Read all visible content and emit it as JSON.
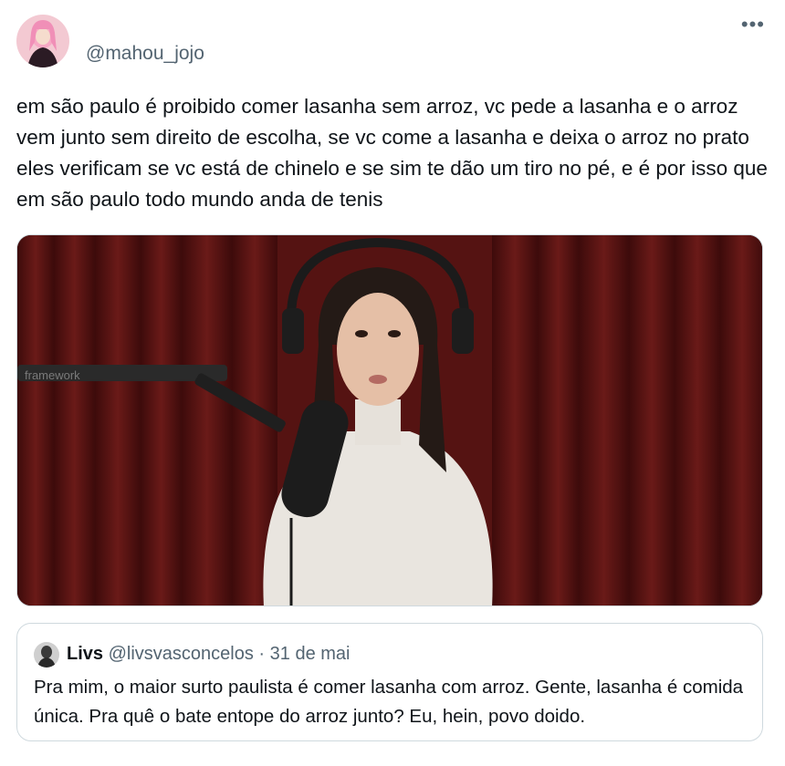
{
  "tweet": {
    "handle": "@mahou_jojo",
    "more_icon": "more-icon",
    "more_glyph": "•••",
    "text": "em são paulo é proibido comer lasanha sem arroz, vc pede a lasanha e o arroz vem junto sem direito de escolha, se vc come a lasanha e deixa o arroz no prato eles verificam se vc está de chinelo e se sim te dão um tiro no pé, e é por isso que em são paulo todo mundo anda de tenis",
    "media_watermark": "framework"
  },
  "quoted": {
    "name": "Livs",
    "handle": "@livsvasconcelos",
    "separator": "·",
    "date": "31 de mai",
    "text": "Pra mim, o maior surto paulista é comer lasanha com arroz. Gente, lasanha é comida única. Pra quê o bate entope do arroz junto? Eu, hein, povo doido."
  },
  "colors": {
    "text": "#0f1419",
    "secondary": "#536471",
    "border": "#cfd9de",
    "curtain": "#5a1414"
  }
}
